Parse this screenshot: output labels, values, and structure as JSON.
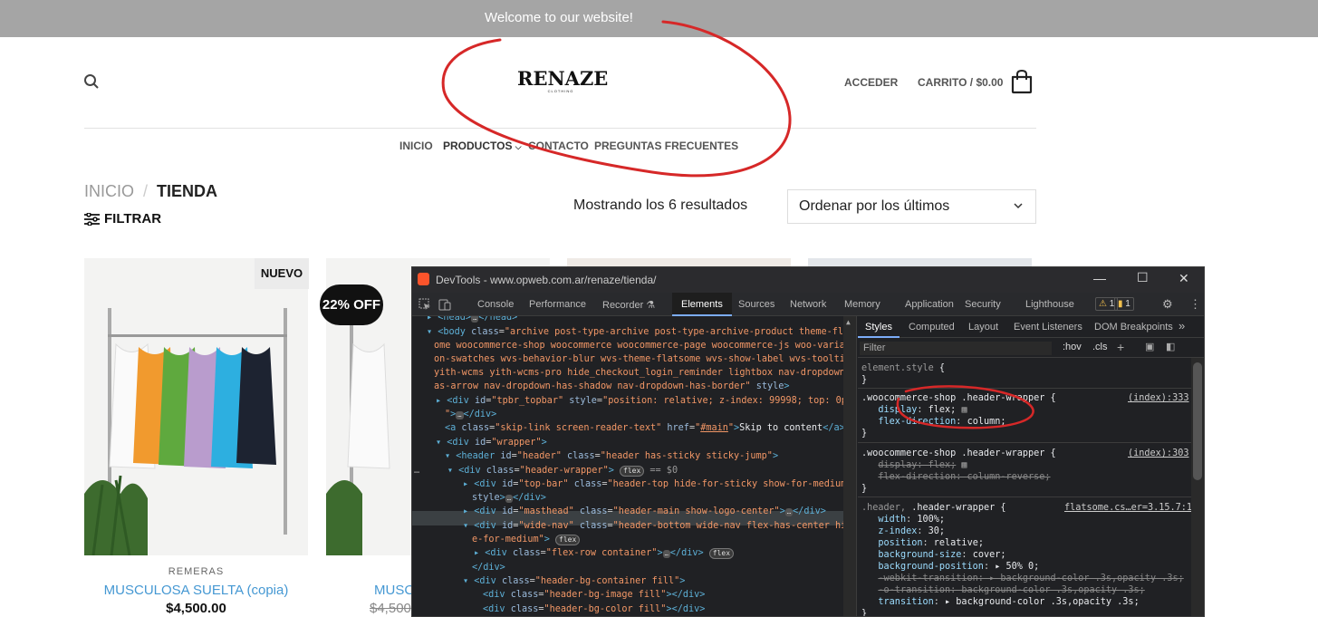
{
  "topbar": {
    "text": "Welcome to our website!"
  },
  "header": {
    "logo_main": "RENAZE",
    "logo_sub": "CLOTHING",
    "login": "ACCEDER",
    "cart": "CARRITO / $0.00"
  },
  "nav": {
    "items": [
      "INICIO",
      "PRODUCTOS",
      "CONTACTO",
      "PREGUNTAS FRECUENTES"
    ]
  },
  "breadcrumb": {
    "home": "INICIO",
    "sep": "/",
    "current": "TIENDA"
  },
  "filter": {
    "label": "FILTRAR"
  },
  "results": {
    "text": "Mostrando los 6 resultados",
    "sort": "Ordenar por los últimos"
  },
  "products": [
    {
      "badge": "NUEVO",
      "category": "REMERAS",
      "name": "MUSCULOSA SUELTA (copia)",
      "price": "$4,500.00"
    },
    {
      "badge": "22% OFF",
      "name": "MUSC",
      "old_price": "$4,500"
    }
  ],
  "devtools": {
    "title": "DevTools - www.opweb.com.ar/renaze/tienda/",
    "tabs": [
      "Console",
      "Performance",
      "Recorder ⚗",
      "Elements",
      "Sources",
      "Network",
      "Memory",
      "Application",
      "Security",
      "Lighthouse"
    ],
    "warn_count": "1",
    "info_count": "1",
    "style_tabs": [
      "Styles",
      "Computed",
      "Layout",
      "Event Listeners",
      "DOM Breakpoints"
    ],
    "filter_placeholder": "Filter",
    "hov": ":hov",
    "cls": ".cls"
  },
  "colors": {
    "topbar": "#a5a5a5",
    "link": "#4598d3",
    "annotation": "#d62828"
  }
}
